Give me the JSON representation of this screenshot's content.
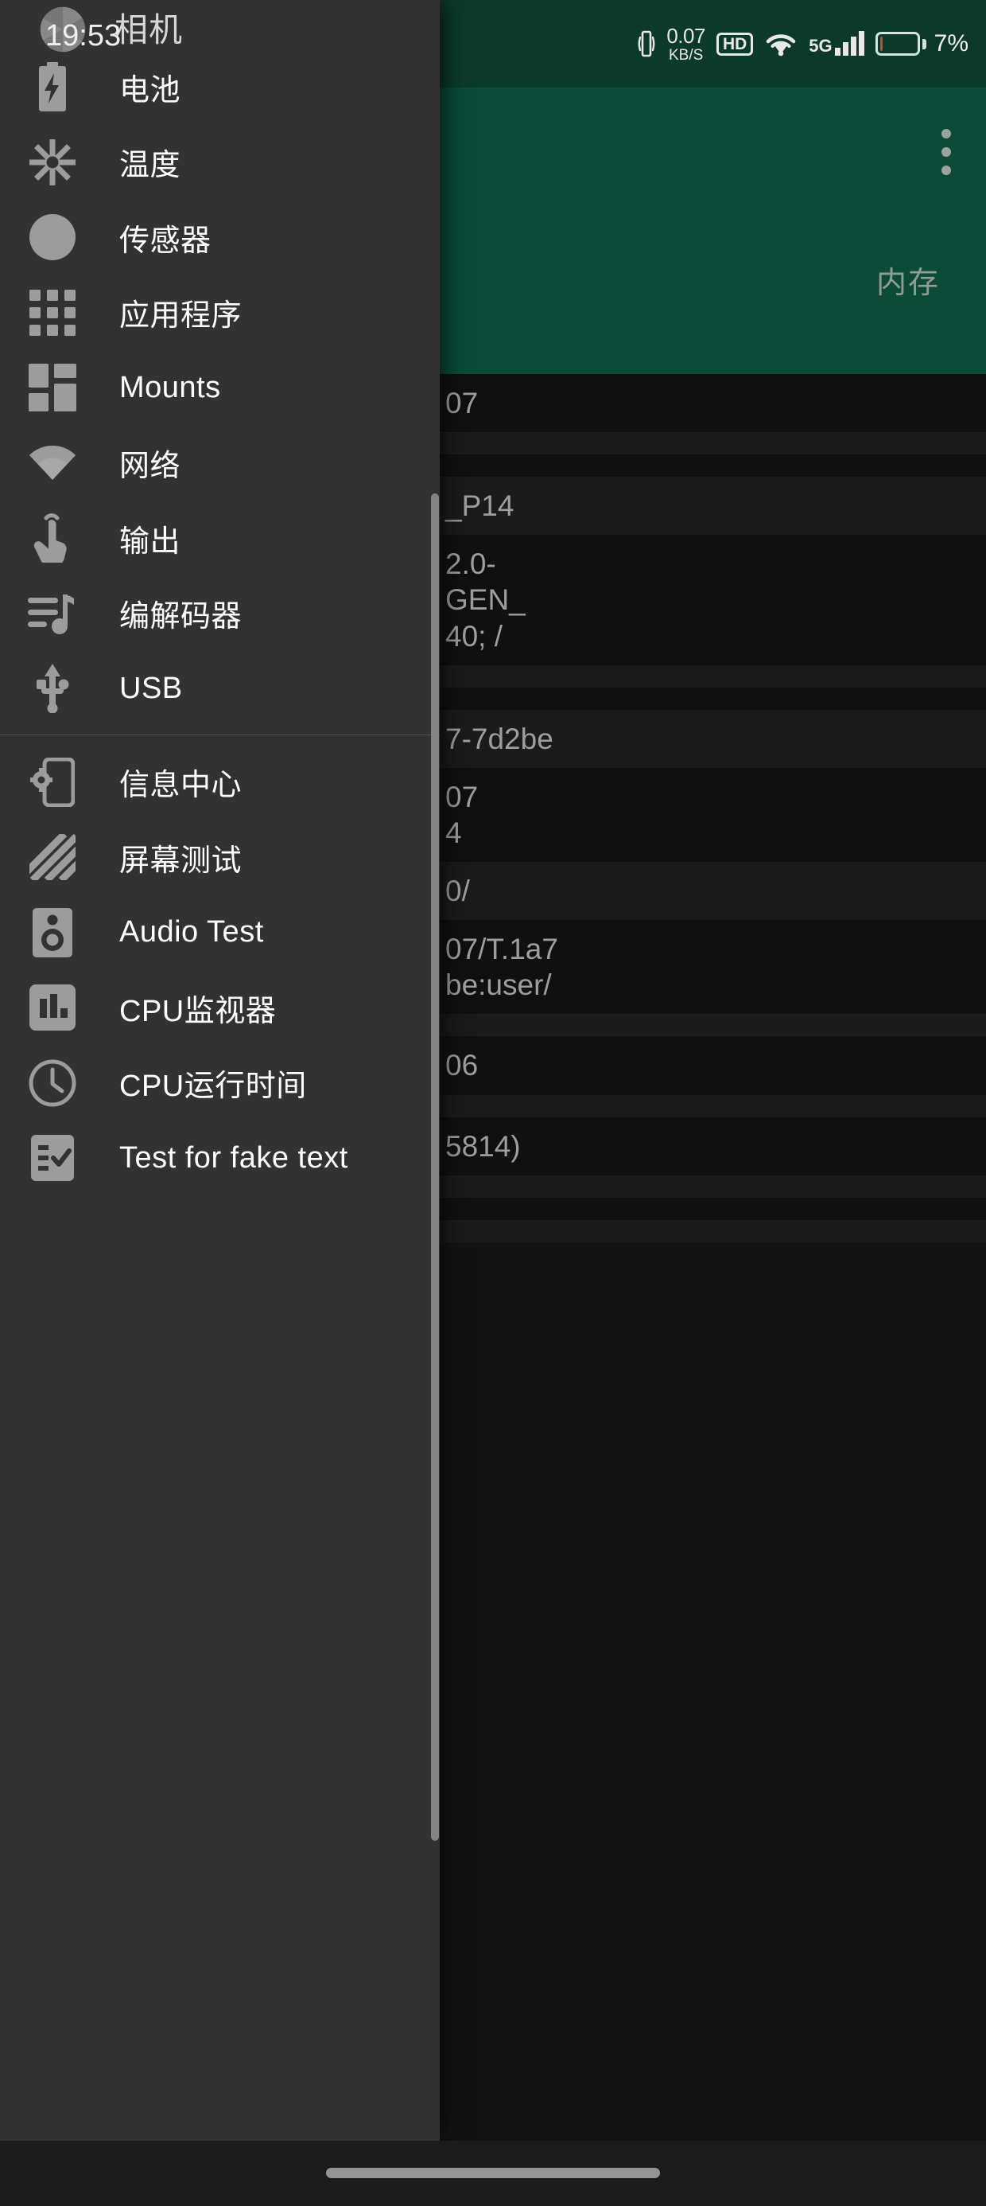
{
  "status_bar": {
    "time": "19:53",
    "vibrate_icon": "vibrate-icon",
    "net_speed_value": "0.07",
    "net_speed_unit": "KB/S",
    "hd_label": "HD",
    "wifi_icon": "wifi-icon",
    "network_type": "5G",
    "signal_icon": "signal-bars-icon",
    "battery_percent": "7%",
    "battery_level": 7,
    "battery_color": "#e03b3b"
  },
  "background_app": {
    "app_bar_color": "#0b4b38",
    "status_bar_color": "#0b3a2b",
    "overflow_icon": "more-vertical-icon",
    "tab_label": "内存",
    "rows": [
      {
        "text": "07",
        "style": "dark"
      },
      {
        "text": "",
        "style": "alt"
      },
      {
        "text": "",
        "style": "dark"
      },
      {
        "text": "_P14",
        "style": "alt"
      },
      {
        "text": "2.0-\nGEN_\n40; /",
        "style": "dark"
      },
      {
        "text": "",
        "style": "alt"
      },
      {
        "text": "",
        "style": "dark"
      },
      {
        "text": "7-7d2be",
        "style": "alt"
      },
      {
        "text": "07\n4",
        "style": "dark"
      },
      {
        "text": "0/",
        "style": "alt"
      },
      {
        "text": "07/T.1a7\nbe:user/",
        "style": "dark"
      },
      {
        "text": "",
        "style": "alt"
      },
      {
        "text": "06",
        "style": "dark"
      },
      {
        "text": "",
        "style": "alt"
      },
      {
        "text": "5814)",
        "style": "dark"
      },
      {
        "text": "",
        "style": "alt"
      },
      {
        "text": "",
        "style": "dark"
      },
      {
        "text": "",
        "style": "alt"
      }
    ]
  },
  "drawer": {
    "app_icon": "camera-aperture-icon",
    "title": "相机",
    "items": [
      {
        "label": "电池",
        "icon": "battery-icon"
      },
      {
        "label": "温度",
        "icon": "snowflake-icon"
      },
      {
        "label": "传感器",
        "icon": "compass-icon"
      },
      {
        "label": "应用程序",
        "icon": "apps-grid-icon"
      },
      {
        "label": "Mounts",
        "icon": "dashboard-icon"
      },
      {
        "label": "网络",
        "icon": "wifi-icon"
      },
      {
        "label": "输出",
        "icon": "touch-tap-icon"
      },
      {
        "label": "编解码器",
        "icon": "music-queue-icon"
      },
      {
        "label": "USB",
        "icon": "usb-icon"
      }
    ],
    "items_secondary": [
      {
        "label": "信息中心",
        "icon": "phone-settings-icon"
      },
      {
        "label": "屏幕测试",
        "icon": "diagonal-stripes-icon"
      },
      {
        "label": "Audio Test",
        "icon": "speaker-icon"
      },
      {
        "label": "CPU监视器",
        "icon": "bar-chart-icon"
      },
      {
        "label": "CPU运行时间",
        "icon": "clock-icon"
      },
      {
        "label": "Test for fake text",
        "icon": "checklist-icon"
      }
    ]
  },
  "nav_bar": {
    "gesture_pill": "home-gesture-pill"
  }
}
